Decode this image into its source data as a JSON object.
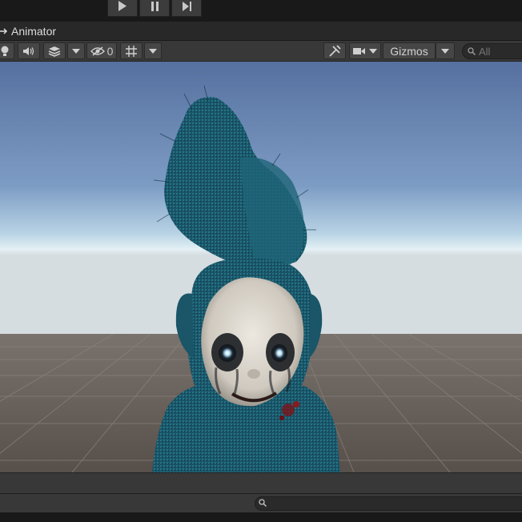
{
  "play_controls": {
    "play_icon": "play-icon",
    "pause_icon": "pause-icon",
    "step_icon": "step-icon"
  },
  "tab": {
    "title": "Animator",
    "icon": "animator-icon"
  },
  "scene_toolbar": {
    "hidden_count": "0",
    "gizmos_label": "Gizmos",
    "search_placeholder": "All",
    "icons": [
      "lighting-icon",
      "audio-icon",
      "effects-icon",
      "visibility-icon",
      "grid-icon",
      "tools-icon",
      "camera-icon",
      "search-icon"
    ]
  },
  "bottom_bar": {
    "search_placeholder": "",
    "search_icon": "search-icon"
  },
  "colors": {
    "sky_top": "#5a78aa",
    "sky_horizon": "#d6e8ef",
    "ground": "#5a524c",
    "character_blue": "#1c5a6c",
    "face": "#d8d4cc"
  }
}
